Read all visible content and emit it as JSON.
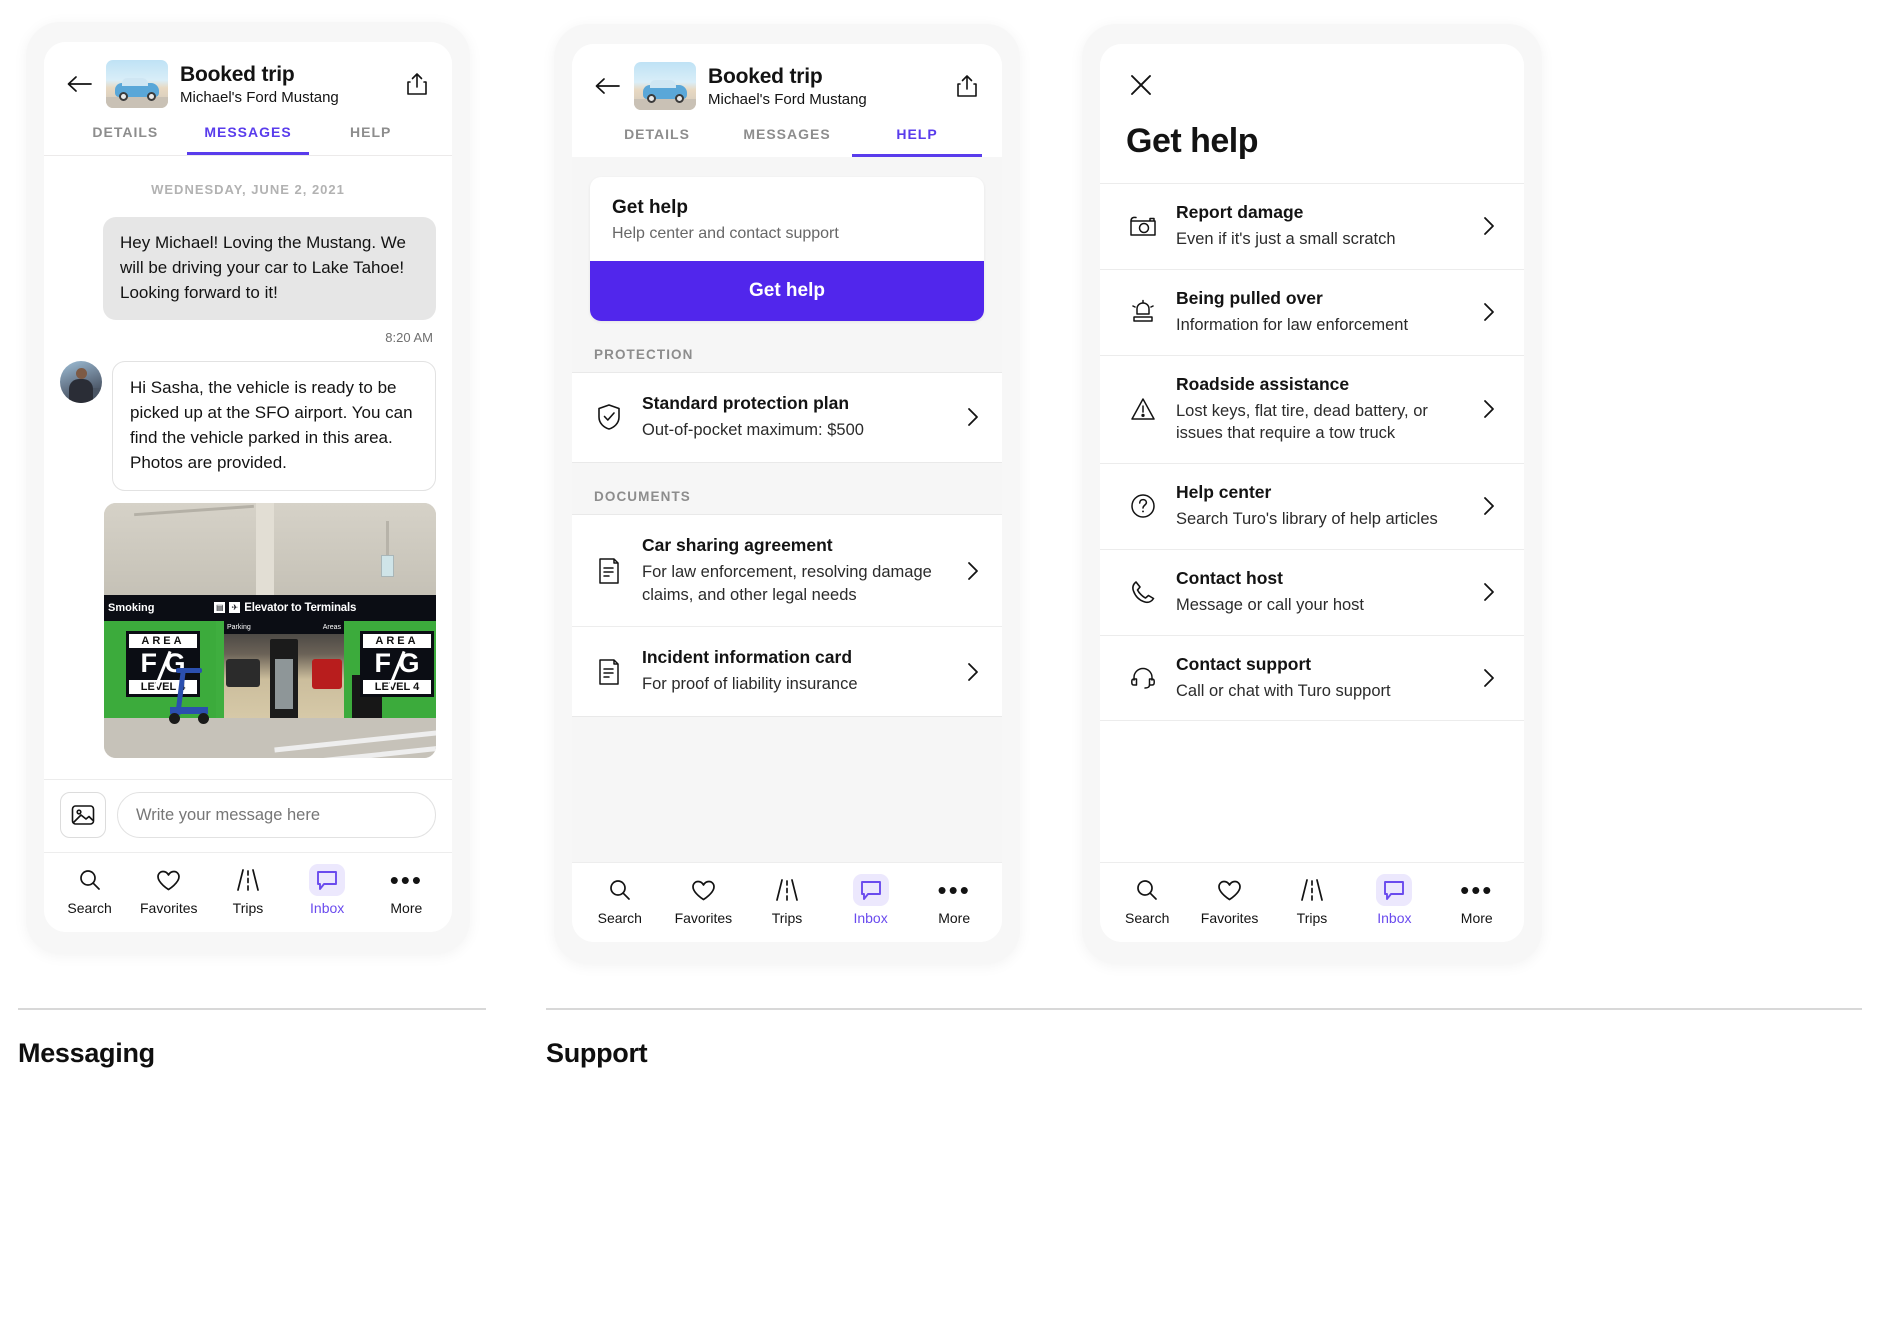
{
  "trip_header": {
    "title": "Booked trip",
    "subtitle": "Michael's Ford Mustang",
    "back_icon": "back-arrow-icon",
    "share_icon": "share-icon",
    "tabs": [
      {
        "label": "DETAILS",
        "active": false
      },
      {
        "label": "MESSAGES",
        "active": true
      },
      {
        "label": "HELP",
        "active": false
      }
    ],
    "tabs_panel2": [
      {
        "label": "DETAILS",
        "active": false
      },
      {
        "label": "MESSAGES",
        "active": false
      },
      {
        "label": "HELP",
        "active": true
      }
    ]
  },
  "messages": {
    "daystamp": "WEDNESDAY, JUNE 2, 2021",
    "outgoing": {
      "text": "Hey Michael! Loving the Mustang. We will be driving your car to Lake Tahoe! Looking forward to it!",
      "timestamp": "8:20 AM"
    },
    "incoming": {
      "text": "Hi Sasha, the vehicle is ready to be picked up at the SFO airport.  You can find the vehicle parked in this area. Photos are provided.",
      "attachment_alt": "Airport parking garage photo"
    },
    "photo_signs": {
      "top_left": "Smoking",
      "top_center": "Elevator to Terminals",
      "area_label": "AREA",
      "area_letters_top": "F",
      "area_letters_bottom": "G",
      "level": "LEVEL 4",
      "garage_bar_left": "Parking",
      "garage_bar_right": "Areas"
    },
    "composer": {
      "image_icon": "image-attachment-icon",
      "placeholder": "Write your message here",
      "value": ""
    }
  },
  "bottom_nav": {
    "items": [
      {
        "label": "Search",
        "icon": "search-icon",
        "active": false
      },
      {
        "label": "Favorites",
        "icon": "heart-icon",
        "active": false
      },
      {
        "label": "Trips",
        "icon": "road-icon",
        "active": false
      },
      {
        "label": "Inbox",
        "icon": "chat-icon",
        "active": true
      },
      {
        "label": "More",
        "icon": "ellipsis-icon",
        "active": false
      }
    ]
  },
  "help_tab": {
    "card": {
      "title": "Get help",
      "subtitle": "Help center and contact support",
      "button_label": "Get help"
    },
    "protection_label": "PROTECTION",
    "protection_rows": [
      {
        "title": "Standard  protection plan",
        "subtitle": "Out-of-pocket maximum: $500",
        "icon": "shield-check-icon"
      }
    ],
    "documents_label": "DOCUMENTS",
    "document_rows": [
      {
        "title": "Car sharing agreement",
        "subtitle": "For law enforcement, resolving damage claims, and other legal needs",
        "icon": "document-icon"
      },
      {
        "title": "Incident information card",
        "subtitle": "For proof of liability insurance",
        "icon": "document-icon"
      }
    ]
  },
  "get_help_sheet": {
    "close_icon": "close-icon",
    "title": "Get help",
    "items": [
      {
        "title": "Report damage",
        "subtitle": "Even if it's just a small scratch",
        "icon": "camera-icon"
      },
      {
        "title": "Being pulled over",
        "subtitle": "Information for law enforcement",
        "icon": "police-light-icon"
      },
      {
        "title": "Roadside assistance",
        "subtitle": "Lost keys, flat tire, dead battery, or issues that require a tow truck",
        "icon": "warning-triangle-icon"
      },
      {
        "title": "Help center",
        "subtitle": "Search Turo's library of help articles",
        "icon": "question-circle-icon"
      },
      {
        "title": "Contact host",
        "subtitle": "Message or call your host",
        "icon": "phone-icon"
      },
      {
        "title": "Contact support",
        "subtitle": "Call or chat with Turo support",
        "icon": "headset-icon"
      }
    ]
  },
  "captions": {
    "left": "Messaging",
    "right": "Support"
  },
  "colors": {
    "accent_purple": "#5126ec",
    "tab_active": "#593cec",
    "bubble_grey": "#e6e6e6",
    "page_bg": "#f6f6f6"
  }
}
